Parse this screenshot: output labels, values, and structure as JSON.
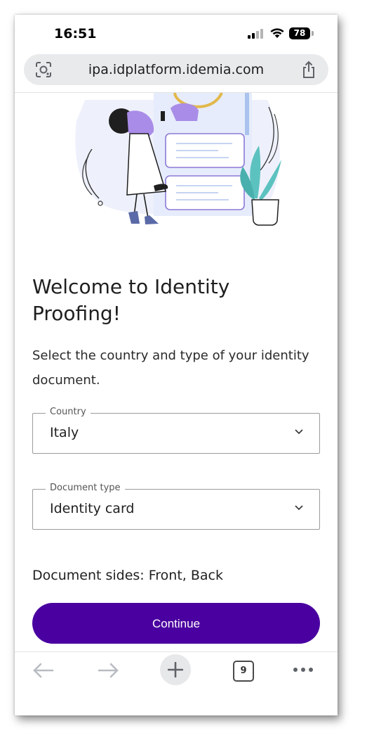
{
  "status_bar": {
    "time": "16:51",
    "battery": "78"
  },
  "browser": {
    "url": "ipa.idplatform.idemia.com",
    "tabs_count": "9",
    "icons": {
      "lens": "lens-icon",
      "share": "share-icon",
      "back": "back-arrow-icon",
      "forward": "forward-arrow-icon",
      "new_tab": "plus-icon",
      "tabs": "tabs-icon",
      "more": "more-icon"
    }
  },
  "page": {
    "title": "Welcome to Identity Proofing!",
    "subtitle": "Select the country and type of your identity document.",
    "country_field": {
      "label": "Country",
      "value": "Italy"
    },
    "document_type_field": {
      "label": "Document type",
      "value": "Identity card"
    },
    "document_sides": "Document sides: Front, Back",
    "continue_label": "Continue"
  },
  "colors": {
    "primary": "#4a00a0",
    "illustration_accent": "#a98ce8",
    "plant": "#5cc2c0",
    "gold": "#e2b84a"
  }
}
